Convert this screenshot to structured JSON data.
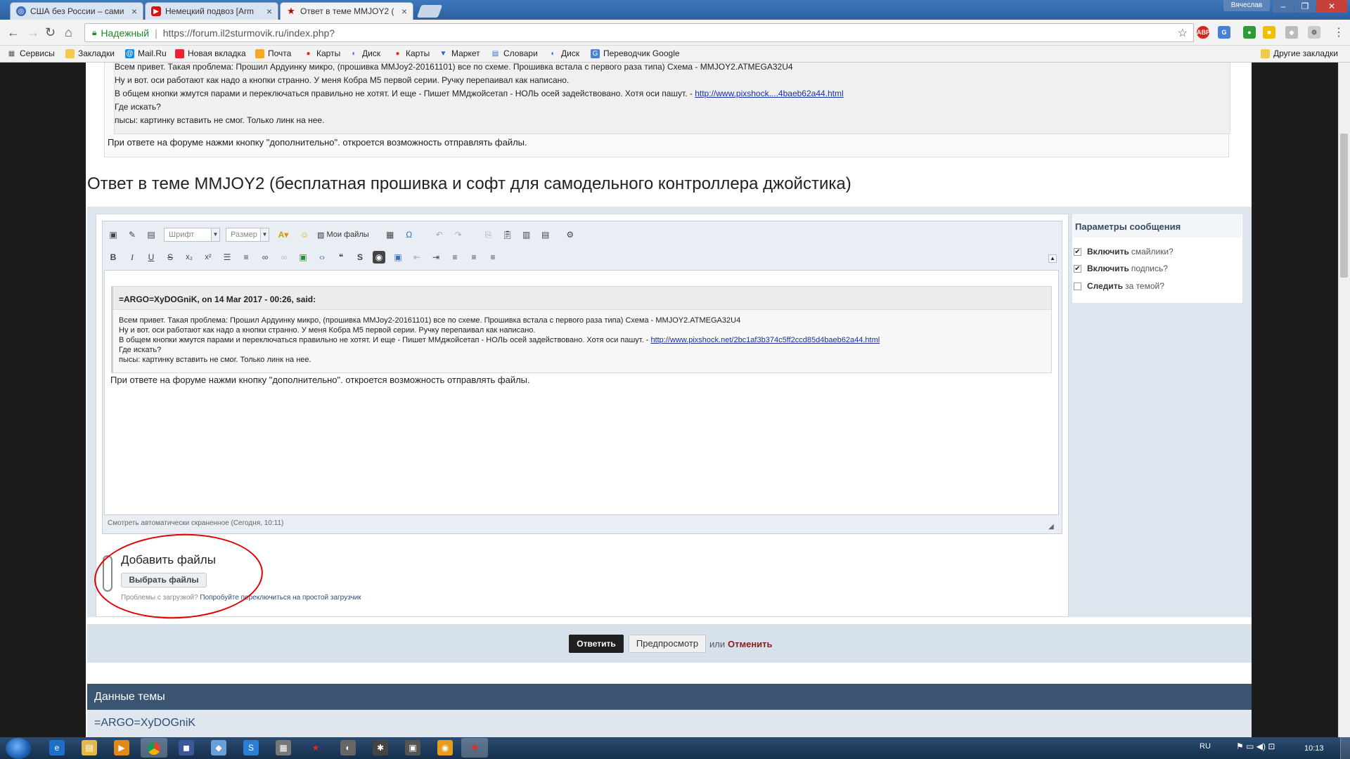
{
  "browser": {
    "tabs": [
      {
        "title": "США без России – сами",
        "icon": "globe-icon",
        "active": false
      },
      {
        "title": "Немецкий подвоз [Arm",
        "icon": "youtube-icon",
        "active": false
      },
      {
        "title": "Ответ в теме MMJOY2 (",
        "icon": "star-icon",
        "active": true
      }
    ],
    "user": "Вячеслав",
    "security_label": "Надежный",
    "url": "https://forum.il2sturmovik.ru/index.php?",
    "ext_abp": "ABP",
    "bookmarks": [
      {
        "label": "Сервисы",
        "icon": "apps-grid-icon"
      },
      {
        "label": "Закладки",
        "icon": "folder-icon"
      },
      {
        "label": "Mail.Ru",
        "icon": "mailru-icon"
      },
      {
        "label": "Новая вкладка",
        "icon": "bookmark-icon"
      },
      {
        "label": "Почта",
        "icon": "mail-icon"
      },
      {
        "label": "Карты",
        "icon": "map-pin-icon"
      },
      {
        "label": "Диск",
        "icon": "disk-icon"
      },
      {
        "label": "Карты",
        "icon": "map-pin-icon"
      },
      {
        "label": "Маркет",
        "icon": "cart-icon"
      },
      {
        "label": "Словари",
        "icon": "dictionary-icon"
      },
      {
        "label": "Диск",
        "icon": "disk-icon"
      },
      {
        "label": "Переводчик Google",
        "icon": "translate-icon"
      }
    ],
    "other_bookmarks": "Другие закладки"
  },
  "top_quote": {
    "lines": [
      "Всем привет. Такая проблема: Прошил Ардуинку микро, (прошивка MMJoy2-20161101) все по схеме. Прошивка встала с первого раза типа) Схема - MMJOY2.ATMEGA32U4",
      "Ну и вот. оси работают как надо а кнопки странно. У меня Кобра М5 первой серии. Ручку перепаивал как написано.",
      "В общем кнопки жмутся парами и переключаться правильно не хотят. И еще - Пишет ММджойсетап - НОЛЬ осей задействовано. Хотя оси пашут. -",
      "Где искать?",
      "пысы: картинку вставить не смог. Только линк на нее."
    ],
    "link": "http://www.pixshock....4baeb62a44.html",
    "after": "При ответе на форуме нажми кнопку \"дополнительно\". откроется возможность отправлять файлы."
  },
  "reply_title": "Ответ в теме MMJOY2 (бесплатная прошивка и софт для самодельного контроллера джойстика)",
  "editor": {
    "font_select": "Шрифт",
    "size_select": "Размер",
    "my_files": "Мои файлы",
    "quote_header": "=ARGO=XyDOGniK, on 14 Mar 2017 - 00:26, said:",
    "quote_lines": [
      "Всем привет. Такая проблема: Прошил Ардуинку микро, (прошивка MMJoy2-20161101) все по схеме. Прошивка встала с первого раза типа) Схема - MMJOY2.ATMEGA32U4",
      "Ну и вот. оси работают как надо а кнопки странно. У меня Кобра М5 первой серии. Ручку перепаивал как написано.",
      "В общем кнопки жмутся парами и переключаться правильно не хотят. И еще - Пишет ММджойсетап - НОЛЬ осей задействовано. Хотя оси пашут. -",
      "Где искать?",
      "пысы: картинку вставить не смог. Только линк на нее."
    ],
    "quote_link": "http://www.pixshock.net/2bc1af3b374c5ff2ccd85d4baeb62a44.html",
    "after_quote": "При ответе на форуме нажми кнопку \"дополнительно\". откроется возможность отправлять файлы.",
    "autosave": "Смотреть автоматически скраненное (Сегодня, 10:11)"
  },
  "params": {
    "title": "Параметры сообщения",
    "options": [
      {
        "bold": "Включить",
        "rest": "смайлики?",
        "checked": true
      },
      {
        "bold": "Включить",
        "rest": "подпись?",
        "checked": true
      },
      {
        "bold": "Следить",
        "rest": "за темой?",
        "checked": false
      }
    ]
  },
  "attach": {
    "title": "Добавить файлы",
    "button": "Выбрать файлы",
    "help_prefix": "Проблемы с загрузкой?",
    "help_link": "Попробуйте переключиться на простой загрузчик"
  },
  "submit": {
    "reply": "Ответить",
    "preview": "Предпросмотр",
    "or": "или",
    "cancel": "Отменить"
  },
  "topic_data": {
    "title": "Данные темы",
    "author": "=ARGO=XyDOGniK"
  },
  "taskbar": {
    "lang": "RU",
    "time": "10:13"
  }
}
